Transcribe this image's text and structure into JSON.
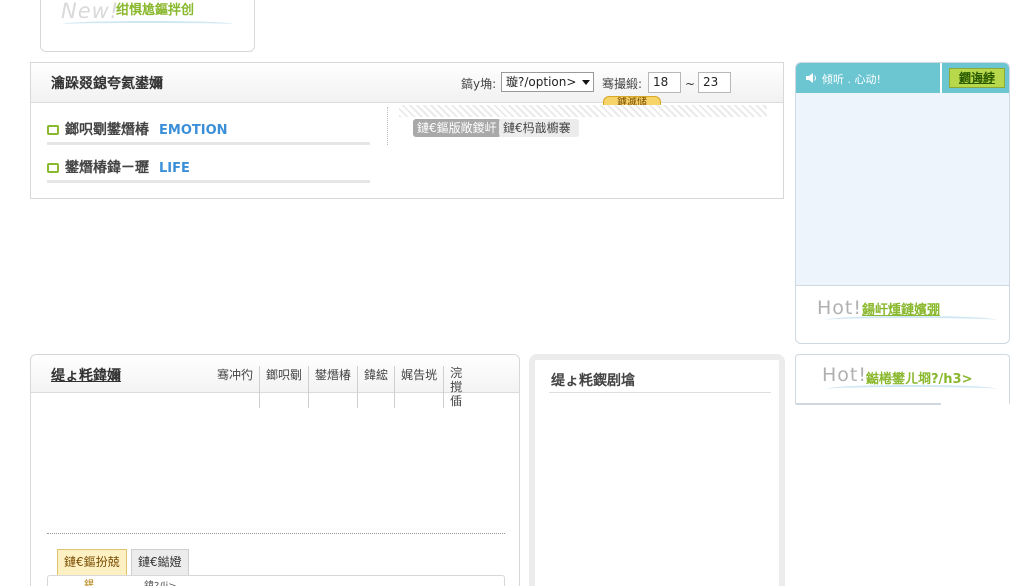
{
  "new_box": {
    "badge": "New!",
    "title": "绀惧尯鏂拌创"
  },
  "search": {
    "title": "瀹跺叕鎴夸氦鍙嬭",
    "gender_label": "鎬у埆:",
    "gender_value": "璇?/option>",
    "age_label": "骞撮緞:",
    "age_min": "18",
    "age_tilde": "~",
    "age_max": "23",
    "search_button": "鎼滅储",
    "categories": [
      {
        "label": "鎯呮劅鐢熸椿",
        "en": "EMOTION"
      },
      {
        "label": "鐢熸椿鍏ㄧ瓑",
        "en": "LIFE"
      }
    ],
    "tags": [
      "鏈€鏂版敞鍐屽",
      "鏈€杩戠櫥褰"
    ]
  },
  "sidebar": {
    "caption": "倾听 . 心动!",
    "login_button": "鐧诲綍",
    "hot1_badge": "Hot!",
    "hot1_title": "鍚屽煄鏈嬪弸",
    "hot2_badge": "Hot!",
    "hot2_title": "鐑棬鐢ㄦ埛?/h3>"
  },
  "news": {
    "title": "缇ょ粍鍏嬭",
    "tabs": [
      "骞冲彴",
      "鎯呮劅",
      "鐢熸椿",
      "鍏綋",
      "娓告垙",
      "浣撹偛"
    ],
    "bottom_tabs": [
      "鏈€鏂扮兢",
      "鏈€鐑嬁"
    ],
    "list_a": "鍟",
    "list_b": "鍏?/li>"
  },
  "mid": {
    "title": "缇ょ粍鍥剧墖"
  },
  "colors": {
    "accent_green": "#8ab82e",
    "accent_blue": "#3a8fd8",
    "sidebar_teal": "#6cc6d2"
  }
}
